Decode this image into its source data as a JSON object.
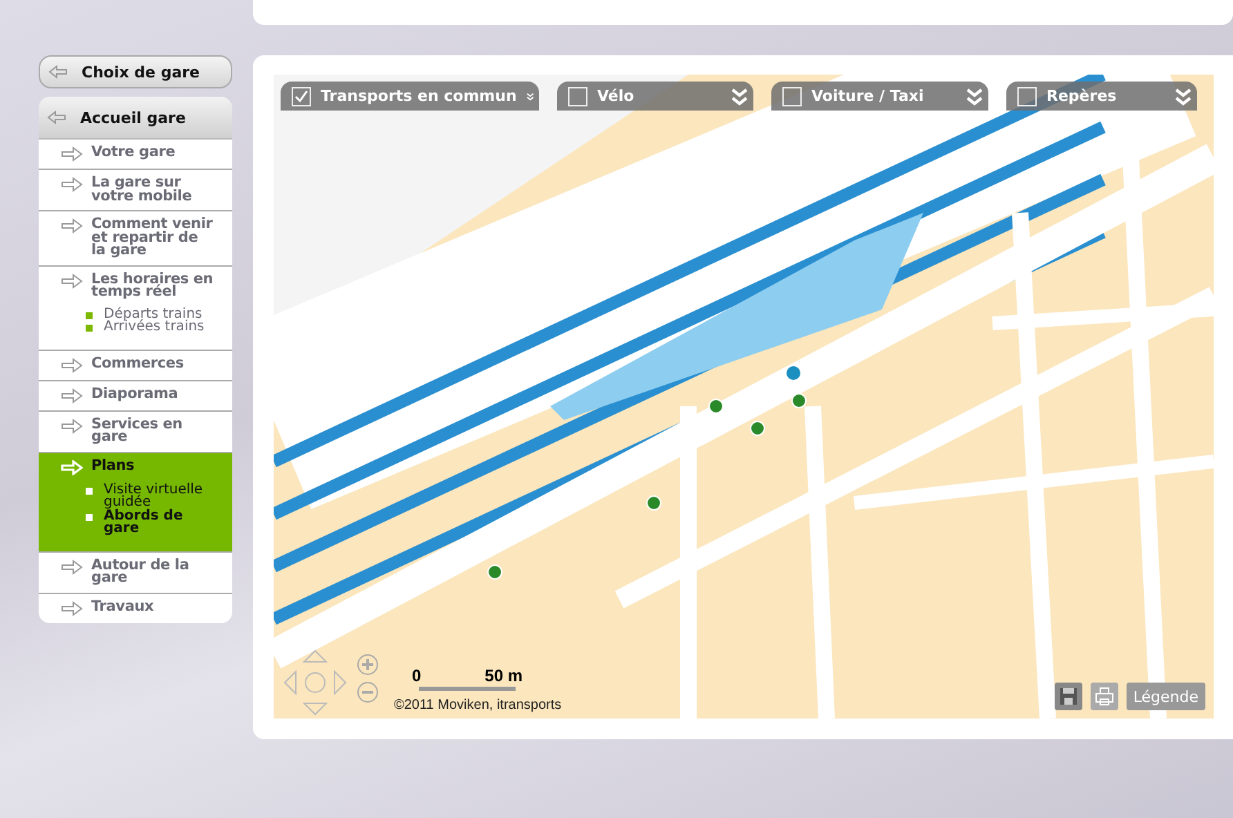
{
  "sidebar": {
    "back_button": "Choix de gare",
    "home_button": "Accueil gare",
    "items": [
      {
        "label": "Votre gare",
        "selected": false
      },
      {
        "label": "La gare sur votre mobile",
        "selected": false
      },
      {
        "label": "Comment venir et repartir de la gare",
        "selected": false
      },
      {
        "label": "Les horaires en temps réel",
        "selected": false,
        "children": [
          {
            "label": "Départs trains",
            "selected": false
          },
          {
            "label": "Arrivées trains",
            "selected": false
          }
        ]
      },
      {
        "label": "Commerces",
        "selected": false
      },
      {
        "label": "Diaporama",
        "selected": false
      },
      {
        "label": "Services en gare",
        "selected": false
      },
      {
        "label": "Plans",
        "selected": true,
        "children": [
          {
            "label": "Visite virtuelle guidée",
            "selected": false
          },
          {
            "label": "Abords de gare",
            "selected": true
          }
        ]
      },
      {
        "label": "Autour de la gare",
        "selected": false
      },
      {
        "label": "Travaux",
        "selected": false
      }
    ]
  },
  "map": {
    "layers": [
      {
        "label": "Transports en commun",
        "checked": true
      },
      {
        "label": "Vélo",
        "checked": false
      },
      {
        "label": "Voiture / Taxi",
        "checked": false
      },
      {
        "label": "Repères",
        "checked": false
      }
    ],
    "scale": {
      "start": "0",
      "end": "50 m"
    },
    "copyright": "©2011 Moviken, itransports",
    "legend_button": "Légende"
  }
}
